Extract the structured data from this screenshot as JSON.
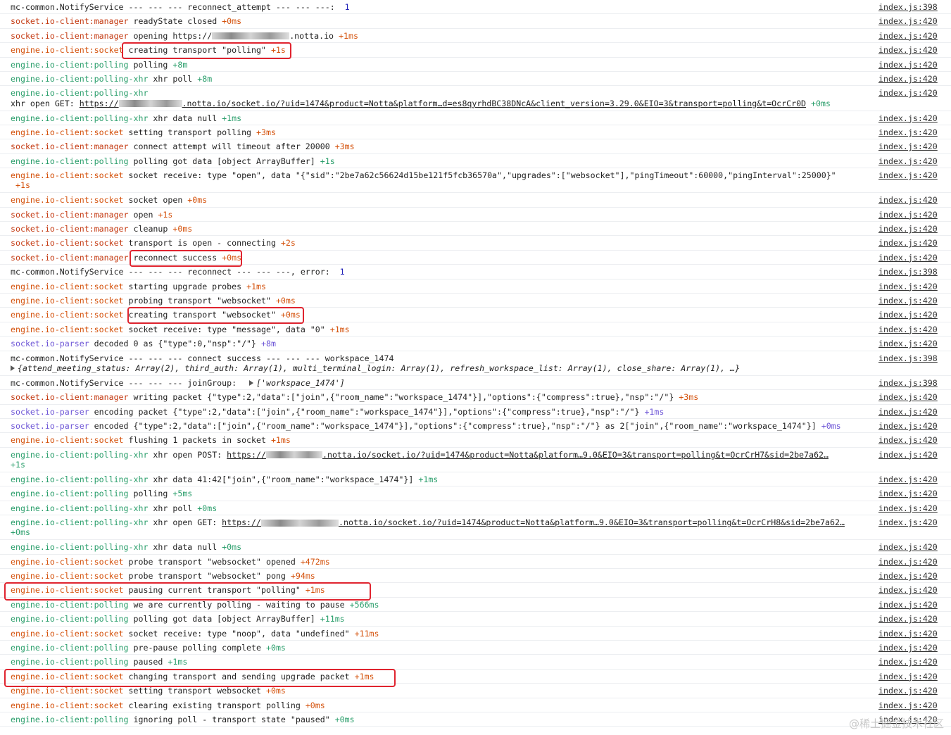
{
  "rows": [
    {
      "ns": "mc-common.NotifyService",
      "text": " --- --- --- reconnect_attempt --- --- ---:  ",
      "num": "1",
      "time": "",
      "src": "index.js:398"
    },
    {
      "ns": "socket.io-client:manager",
      "text": " readyState closed ",
      "time": "+0ms",
      "src": "index.js:420"
    },
    {
      "ns": "socket.io-client:manager",
      "text": " opening https://",
      "text2": ".notta.io ",
      "time": "+1ms",
      "src": "index.js:420"
    },
    {
      "ns": "engine.io-client:socket",
      "text": " creating transport \"polling\" ",
      "time": "+1s",
      "src": "index.js:420"
    },
    {
      "ns": "engine.io-client:polling",
      "text": " polling ",
      "time": "+8m",
      "src": "index.js:420"
    },
    {
      "ns": "engine.io-client:polling-xhr",
      "text": " xhr poll ",
      "time": "+8m",
      "src": "index.js:420"
    },
    {
      "ns": "engine.io-client:polling-xhr",
      "text": "xhr open GET: ",
      "url_pre": "https://",
      "url": ".notta.io/socket.io/?uid=1474&product=Notta&platform…d=es8qyrhdBC38DNcA&client_version=3.29.0&EIO=3&transport=polling&t=OcrCr0D",
      "time": "+0ms",
      "src": "index.js:420"
    },
    {
      "ns": "engine.io-client:polling-xhr",
      "text": " xhr data null ",
      "time": "+1ms",
      "src": "index.js:420"
    },
    {
      "ns": "engine.io-client:socket",
      "text": " setting transport polling ",
      "time": "+3ms",
      "src": "index.js:420"
    },
    {
      "ns": "socket.io-client:manager",
      "text": " connect attempt will timeout after 20000 ",
      "time": "+3ms",
      "src": "index.js:420"
    },
    {
      "ns": "engine.io-client:polling",
      "text": " polling got data [object ArrayBuffer] ",
      "time": "+1s",
      "src": "index.js:420"
    },
    {
      "ns": "engine.io-client:socket",
      "text": " socket receive: type \"open\", data \"{\"sid\":\"2be7a62c56624d15be121f5fcb36570a\",\"upgrades\":[\"websocket\"],\"pingTimeout\":60000,\"pingInterval\":25000}\"",
      "time": "+1s",
      "src": "index.js:420"
    },
    {
      "ns": "engine.io-client:socket",
      "text": " socket open ",
      "time": "+0ms",
      "src": "index.js:420"
    },
    {
      "ns": "socket.io-client:manager",
      "text": " open ",
      "time": "+1s",
      "src": "index.js:420"
    },
    {
      "ns": "socket.io-client:manager",
      "text": " cleanup ",
      "time": "+0ms",
      "src": "index.js:420"
    },
    {
      "ns": "socket.io-client:socket",
      "text": " transport is open - connecting ",
      "time": "+2s",
      "src": "index.js:420"
    },
    {
      "ns": "socket.io-client:manager",
      "text": " reconnect success ",
      "time": "+0ms",
      "src": "index.js:420"
    },
    {
      "ns": "mc-common.NotifyService",
      "text": " --- --- --- reconnect --- --- ---, error:  ",
      "num": "1",
      "time": "",
      "src": "index.js:398"
    },
    {
      "ns": "engine.io-client:socket",
      "text": " starting upgrade probes ",
      "time": "+1ms",
      "src": "index.js:420"
    },
    {
      "ns": "engine.io-client:socket",
      "text": " probing transport \"websocket\" ",
      "time": "+0ms",
      "src": "index.js:420"
    },
    {
      "ns": "engine.io-client:socket",
      "text": " creating transport \"websocket\" ",
      "time": "+0ms",
      "src": "index.js:420"
    },
    {
      "ns": "engine.io-client:socket",
      "text": " socket receive: type \"message\", data \"0\" ",
      "time": "+1ms",
      "src": "index.js:420"
    },
    {
      "ns": "socket.io-parser",
      "text": " decoded 0 as {\"type\":0,\"nsp\":\"/\"} ",
      "time": "+8m",
      "src": "index.js:420"
    },
    {
      "ns": "mc-common.NotifyService",
      "text": " --- --- --- connect success --- --- --- workspace_1474",
      "obj": "{attend_meeting_status: Array(2), third_auth: Array(1), multi_terminal_login: Array(1), refresh_workspace_list: Array(1), close_share: Array(1), …}",
      "time": "",
      "src": "index.js:398"
    },
    {
      "ns": "mc-common.NotifyService",
      "text": " --- --- --- joinGroup:  ",
      "arr": "['workspace_1474']",
      "time": "",
      "src": "index.js:398"
    },
    {
      "ns": "socket.io-client:manager",
      "text": " writing packet {\"type\":2,\"data\":[\"join\",{\"room_name\":\"workspace_1474\"}],\"options\":{\"compress\":true},\"nsp\":\"/\"} ",
      "time": "+3ms",
      "src": "index.js:420"
    },
    {
      "ns": "socket.io-parser",
      "text": " encoding packet {\"type\":2,\"data\":[\"join\",{\"room_name\":\"workspace_1474\"}],\"options\":{\"compress\":true},\"nsp\":\"/\"} ",
      "time": "+1ms",
      "src": "index.js:420"
    },
    {
      "ns": "socket.io-parser",
      "text": " encoded {\"type\":2,\"data\":[\"join\",{\"room_name\":\"workspace_1474\"}],\"options\":{\"compress\":true},\"nsp\":\"/\"} as 2[\"join\",{\"room_name\":\"workspace_1474\"}] ",
      "time": "+0ms",
      "src": "index.js:420"
    },
    {
      "ns": "engine.io-client:socket",
      "text": " flushing 1 packets in socket ",
      "time": "+1ms",
      "src": "index.js:420"
    },
    {
      "ns": "engine.io-client:polling-xhr",
      "text": " xhr open POST: ",
      "url_pre": "https://",
      "url": ".notta.io/socket.io/?uid=1474&product=Notta&platform…9.0&EIO=3&transport=polling&t=OcrCrH7&sid=2be7a62…",
      "time": "+1s",
      "src": "index.js:420"
    },
    {
      "ns": "engine.io-client:polling-xhr",
      "text": " xhr data 41:42[\"join\",{\"room_name\":\"workspace_1474\"}] ",
      "time": "+1ms",
      "src": "index.js:420"
    },
    {
      "ns": "engine.io-client:polling",
      "text": " polling ",
      "time": "+5ms",
      "src": "index.js:420"
    },
    {
      "ns": "engine.io-client:polling-xhr",
      "text": " xhr poll ",
      "time": "+0ms",
      "src": "index.js:420"
    },
    {
      "ns": "engine.io-client:polling-xhr",
      "text": " xhr open GET: ",
      "url_pre": "https://",
      "url": ".notta.io/socket.io/?uid=1474&product=Notta&platform…9.0&EIO=3&transport=polling&t=OcrCrH8&sid=2be7a62…",
      "time": "+0ms",
      "src": "index.js:420"
    },
    {
      "ns": "engine.io-client:polling-xhr",
      "text": " xhr data null ",
      "time": "+0ms",
      "src": "index.js:420"
    },
    {
      "ns": "engine.io-client:socket",
      "text": " probe transport \"websocket\" opened ",
      "time": "+472ms",
      "src": "index.js:420"
    },
    {
      "ns": "engine.io-client:socket",
      "text": " probe transport \"websocket\" pong ",
      "time": "+94ms",
      "src": "index.js:420"
    },
    {
      "ns": "engine.io-client:socket",
      "text": " pausing current transport \"polling\" ",
      "time": "+1ms",
      "src": "index.js:420"
    },
    {
      "ns": "engine.io-client:polling",
      "text": " we are currently polling - waiting to pause ",
      "time": "+566ms",
      "src": "index.js:420"
    },
    {
      "ns": "engine.io-client:polling",
      "text": " polling got data [object ArrayBuffer] ",
      "time": "+11ms",
      "src": "index.js:420"
    },
    {
      "ns": "engine.io-client:socket",
      "text": " socket receive: type \"noop\", data \"undefined\" ",
      "time": "+11ms",
      "src": "index.js:420"
    },
    {
      "ns": "engine.io-client:polling",
      "text": " pre-pause polling complete ",
      "time": "+0ms",
      "src": "index.js:420"
    },
    {
      "ns": "engine.io-client:polling",
      "text": " paused ",
      "time": "+1ms",
      "src": "index.js:420"
    },
    {
      "ns": "engine.io-client:socket",
      "text": " changing transport and sending upgrade packet ",
      "time": "+1ms",
      "src": "index.js:420"
    },
    {
      "ns": "engine.io-client:socket",
      "text": " setting transport websocket ",
      "time": "+0ms",
      "src": "index.js:420"
    },
    {
      "ns": "engine.io-client:socket",
      "text": " clearing existing transport polling ",
      "time": "+0ms",
      "src": "index.js:420"
    },
    {
      "ns": "engine.io-client:polling",
      "text": " ignoring poll - transport state \"paused\" ",
      "time": "+0ms",
      "src": "index.js:420"
    }
  ],
  "watermark": "@稀土掘金技术社区"
}
